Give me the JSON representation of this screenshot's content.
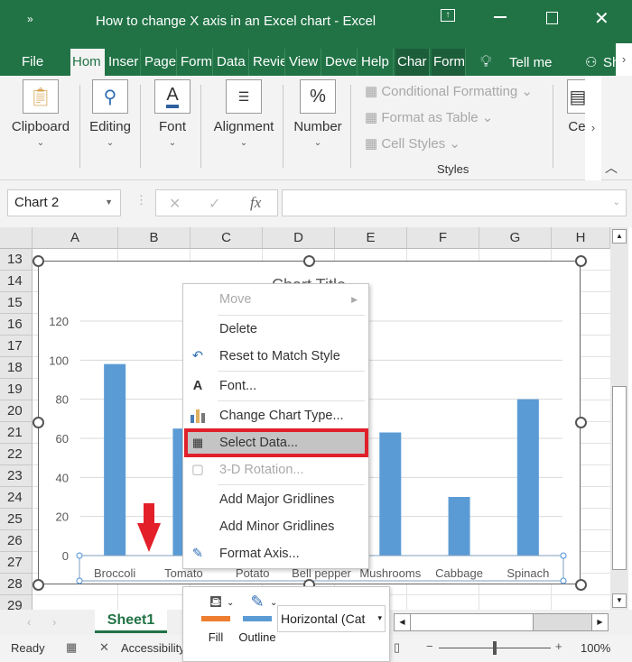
{
  "window": {
    "title": "How to change X axis in an Excel chart  -  Excel",
    "quick_access_icon": "customize-arrows-icon",
    "buttons": [
      "restore-ribbon-icon",
      "minimize-icon",
      "maximize-icon",
      "close-icon"
    ]
  },
  "tabs": [
    {
      "label": "File"
    },
    {
      "label": "Hom",
      "active": true
    },
    {
      "label": "Inser"
    },
    {
      "label": "Page"
    },
    {
      "label": "Form"
    },
    {
      "label": "Data"
    },
    {
      "label": "Revie"
    },
    {
      "label": "View"
    },
    {
      "label": "Deve"
    },
    {
      "label": "Help"
    },
    {
      "label": "Char"
    },
    {
      "label": "Form"
    }
  ],
  "tell_me": "Tell me",
  "share": "Sh",
  "ribbon": {
    "groups": [
      {
        "label": "Clipboard",
        "icon": "clipboard-icon"
      },
      {
        "label": "Editing",
        "icon": "search-icon"
      },
      {
        "label": "Font",
        "icon": "font-color-icon"
      },
      {
        "label": "Alignment",
        "icon": "align-icon"
      },
      {
        "label": "Number",
        "icon": "percent-icon"
      }
    ],
    "styles": {
      "items": [
        "Conditional Formatting",
        "Format as Table",
        "Cell Styles"
      ],
      "label": "Styles"
    },
    "cells_label": "Ce"
  },
  "formula_bar": {
    "name_box": "Chart 2",
    "cancel": "✕",
    "enter": "✓",
    "fx": "fx",
    "value": ""
  },
  "columns": [
    "A",
    "B",
    "C",
    "D",
    "E",
    "F",
    "G",
    "H"
  ],
  "rows": [
    "13",
    "14",
    "15",
    "16",
    "17",
    "18",
    "19",
    "20",
    "21",
    "22",
    "23",
    "24",
    "25",
    "26",
    "27",
    "28",
    "29"
  ],
  "chart_data": {
    "type": "bar",
    "title": "Chart Title",
    "categories": [
      "Broccoli",
      "Tomato",
      "Potato",
      "Bell pepper",
      "Mushrooms",
      "Cabbage",
      "Spinach"
    ],
    "values": [
      98,
      65,
      null,
      null,
      63,
      30,
      80
    ],
    "yticks": [
      "0",
      "20",
      "40",
      "60",
      "80",
      "100",
      "120"
    ],
    "ylim": [
      0,
      120
    ],
    "grid": true,
    "color": "#5b9bd5"
  },
  "context_menu": {
    "items": [
      {
        "label": "Move",
        "disabled": true,
        "submenu": true
      },
      {
        "label": "Delete"
      },
      {
        "label": "Reset to Match Style",
        "icon": "reset-style-icon"
      },
      {
        "label": "Font...",
        "icon": "font-icon"
      },
      {
        "label": "Change Chart Type...",
        "icon": "chart-type-icon"
      },
      {
        "label": "Select Data...",
        "icon": "select-data-icon",
        "highlighted": true
      },
      {
        "label": "3-D Rotation...",
        "disabled": true,
        "icon": "rotation-icon"
      },
      {
        "label": "Add Major Gridlines"
      },
      {
        "label": "Add Minor Gridlines"
      },
      {
        "label": "Format Axis...",
        "icon": "format-axis-icon"
      }
    ]
  },
  "highlight_color": "#e0202a",
  "mini_toolbar": {
    "fill": "Fill",
    "outline": "Outline",
    "element_select": "Horizontal (Cat",
    "fill_color": "#ed7d31",
    "outline_color": "#5b9bd5"
  },
  "sheet_tab": "Sheet1",
  "status": {
    "ready": "Ready",
    "accessibility": "Accessibility",
    "zoom": "100%",
    "zoom_level": 100
  }
}
